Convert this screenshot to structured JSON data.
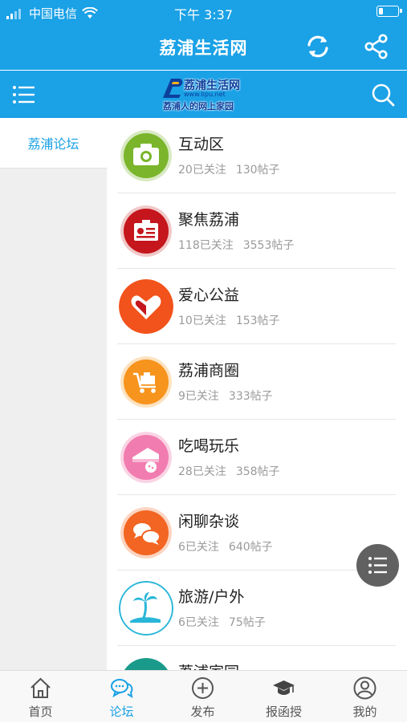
{
  "status_bar": {
    "carrier": "中国电信",
    "time": "下午 3:37"
  },
  "header": {
    "title": "荔浦生活网"
  },
  "logo": {
    "line1": "荔浦生活网",
    "line2": "www.lipu.net",
    "line3": "荔浦人的网上家园"
  },
  "sidebar": {
    "items": [
      {
        "label": "荔浦论坛",
        "active": true
      }
    ]
  },
  "forums": [
    {
      "name": "互动区",
      "followers": "20已关注",
      "posts": "130帖子",
      "icon": "camera-icon",
      "color": "#7ab52b"
    },
    {
      "name": "聚焦荔浦",
      "followers": "118已关注",
      "posts": "3553帖子",
      "icon": "id-card-icon",
      "color": "#c4161c"
    },
    {
      "name": "爱心公益",
      "followers": "10已关注",
      "posts": "153帖子",
      "icon": "heart-hand-icon",
      "color": "#f2521b"
    },
    {
      "name": "荔浦商圈",
      "followers": "9已关注",
      "posts": "333帖子",
      "icon": "cart-icon",
      "color": "#f7941d"
    },
    {
      "name": "吃喝玩乐",
      "followers": "28已关注",
      "posts": "358帖子",
      "icon": "cake-icon",
      "color": "#f17cb0"
    },
    {
      "name": "闲聊杂谈",
      "followers": "6已关注",
      "posts": "640帖子",
      "icon": "chat-bubbles-icon",
      "color": "#f26522"
    },
    {
      "name": "旅游/户外",
      "followers": "6已关注",
      "posts": "75帖子",
      "icon": "palm-tree-icon",
      "color": "#29b6d8"
    },
    {
      "name": "荔浦家园",
      "followers": "",
      "posts": "",
      "icon": "home-icon",
      "color": "#1a9a8a"
    }
  ],
  "tabbar": {
    "items": [
      {
        "label": "首页",
        "icon": "home-icon",
        "active": false
      },
      {
        "label": "论坛",
        "icon": "chat-icon",
        "active": true
      },
      {
        "label": "发布",
        "icon": "plus-circle-icon",
        "active": false
      },
      {
        "label": "报函授",
        "icon": "graduation-cap-icon",
        "active": false
      },
      {
        "label": "我的",
        "icon": "user-icon",
        "active": false
      }
    ]
  },
  "colors": {
    "brand": "#1aa1e6",
    "sidebar_bg": "#efefef",
    "meta_text": "#9a9a9a"
  }
}
